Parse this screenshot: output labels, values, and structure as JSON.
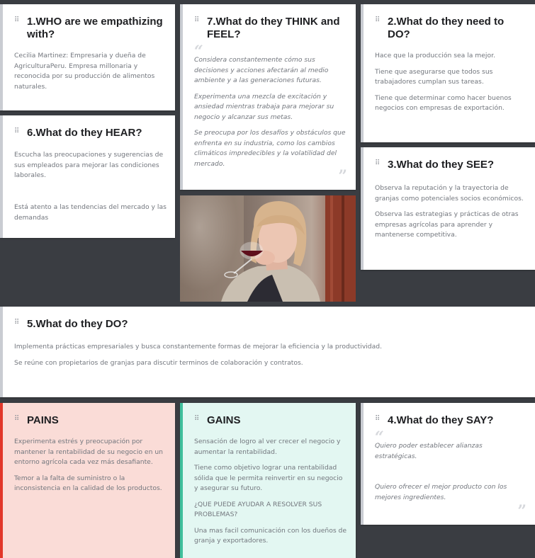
{
  "cards": {
    "who": {
      "title": "1.WHO are we empathizing with?",
      "text": "Cecilia Martinez: Empresaria y dueña de AgriculturaPeru. Empresa millonaria y reconocida por su producción  de alimentos naturales."
    },
    "think": {
      "title": "7.What do they THINK and FEEL?",
      "items": [
        "Considera constantemente cómo sus decisiones y acciones afectarán al medio ambiente y a las generaciones futuras.",
        "Experimenta una mezcla de excitación y ansiedad mientras trabaja para mejorar su negocio y alcanzar sus metas.",
        "Se preocupa por los desafíos y obstáculos que enfrenta en su industria, como los cambios climáticos impredecibles y la volatilidad del mercado."
      ]
    },
    "need": {
      "title": "2.What do they need to DO?",
      "items": [
        "Hace que la producción sea la mejor.",
        "Tiene que asegurarse que todos sus trabajadores cumplan sus tareas.",
        "Tiene que determinar como hacer buenos negocios con empresas de exportación."
      ]
    },
    "hear": {
      "title": "6.What do they HEAR?",
      "items": [
        "Escucha las preocupaciones y sugerencias de sus empleados para mejorar las condiciones laborales.",
        "Está atento a las tendencias del mercado y las demandas"
      ]
    },
    "see": {
      "title": "3.What do they SEE?",
      "items": [
        "Observa la reputación y la trayectoria de granjas como potenciales socios económicos.",
        "Observa las estrategias y prácticas de otras empresas agrícolas para aprender y mantenerse competitiva."
      ]
    },
    "do": {
      "title": "5.What do they DO?",
      "items": [
        "Implementa prácticas empresariales y busca constantemente formas de mejorar la eficiencia y la productividad.",
        "Se reúne con propietarios de granjas para discutir terminos de colaboración y contratos."
      ]
    },
    "pains": {
      "title": "PAINS",
      "items": [
        "Experimenta estrés y preocupación por mantener la rentabilidad de su negocio en un entorno agrícola cada vez más desafiante.",
        "Temor a la falta de suministro o la inconsistencia en la calidad de los productos."
      ]
    },
    "gains": {
      "title": "GAINS",
      "items": [
        "Sensación de logro al ver crecer el negocio y aumentar la rentabilidad.",
        "Tiene como objetivo lograr una rentabilidad sólida que le permita reinvertir en su negocio y asegurar su futuro.",
        "¿QUE PUEDE AYUDAR A RESOLVER SUS PROBLEMAS?",
        "Una mas facil comunicación con los dueños de granja y exportadores."
      ]
    },
    "say": {
      "title": "4.What do they SAY?",
      "items": [
        "Quiero poder establecer alianzas estratégicas.",
        "Quiero ofrecer el mejor producto con los mejores ingredientes."
      ]
    }
  },
  "icons": {
    "drag": "drag-handle-icon",
    "quote_open": "quote-open-icon",
    "quote_close": "quote-close-icon"
  },
  "colors": {
    "background": "#3a3d42",
    "card": "#ffffff",
    "pains_bg": "#fadcd7",
    "pains_accent": "#e2372a",
    "gains_bg": "#e3f7f2",
    "gains_accent": "#3fbf9c"
  }
}
